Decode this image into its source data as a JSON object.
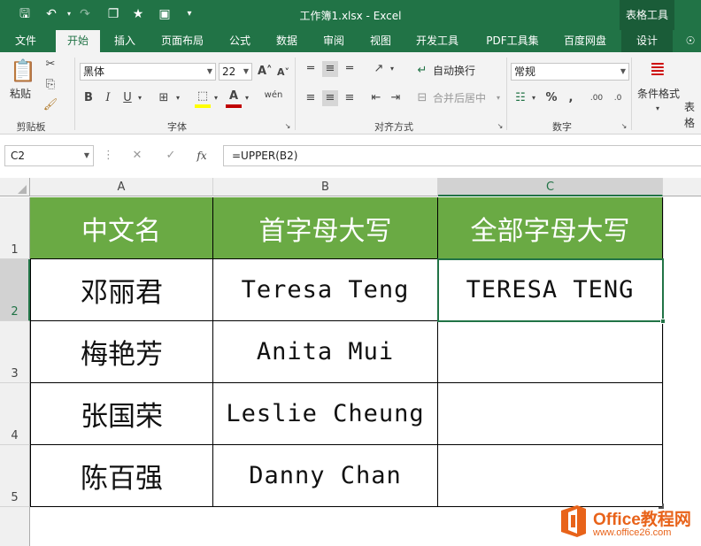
{
  "window": {
    "title": "工作簿1.xlsx - Excel",
    "context_tools": "表格工具"
  },
  "qat": {
    "save_icon": "save-icon",
    "undo_icon": "undo-icon",
    "redo_icon": "redo-icon"
  },
  "tabs": [
    {
      "label": "文件"
    },
    {
      "label": "开始"
    },
    {
      "label": "插入"
    },
    {
      "label": "页面布局"
    },
    {
      "label": "公式"
    },
    {
      "label": "数据"
    },
    {
      "label": "审阅"
    },
    {
      "label": "视图"
    },
    {
      "label": "开发工具"
    },
    {
      "label": "PDF工具集"
    },
    {
      "label": "百度网盘"
    },
    {
      "label": "设计"
    }
  ],
  "ribbon": {
    "clipboard": {
      "label": "剪贴板",
      "paste": "粘贴"
    },
    "font": {
      "label": "字体",
      "name": "黑体",
      "size": "22"
    },
    "alignment": {
      "label": "对齐方式",
      "wrap": "自动换行",
      "merge": "合并后居中"
    },
    "number": {
      "label": "数字",
      "format": "常规"
    },
    "styles": {
      "cond_format": "条件格式",
      "table_fmt": "表格"
    }
  },
  "formula_bar": {
    "name_box": "C2",
    "cancel": "✕",
    "enter": "✓",
    "fx": "fx",
    "formula": "=UPPER(B2)"
  },
  "columns": [
    "A",
    "B",
    "C"
  ],
  "rows": [
    "1",
    "2",
    "3",
    "4",
    "5"
  ],
  "table": {
    "headers": [
      "中文名",
      "首字母大写",
      "全部字母大写"
    ],
    "data": [
      [
        "邓丽君",
        "Teresa Teng",
        "TERESA TENG"
      ],
      [
        "梅艳芳",
        "Anita Mui",
        ""
      ],
      [
        "张国荣",
        "Leslie Cheung",
        ""
      ],
      [
        "陈百强",
        "Danny Chan",
        ""
      ]
    ]
  },
  "watermark": {
    "brand": "Office教程网",
    "url": "www.office26.com"
  },
  "colors": {
    "excel_green": "#217346",
    "header_fill": "#6aaa44",
    "logo_orange": "#e8631a"
  }
}
